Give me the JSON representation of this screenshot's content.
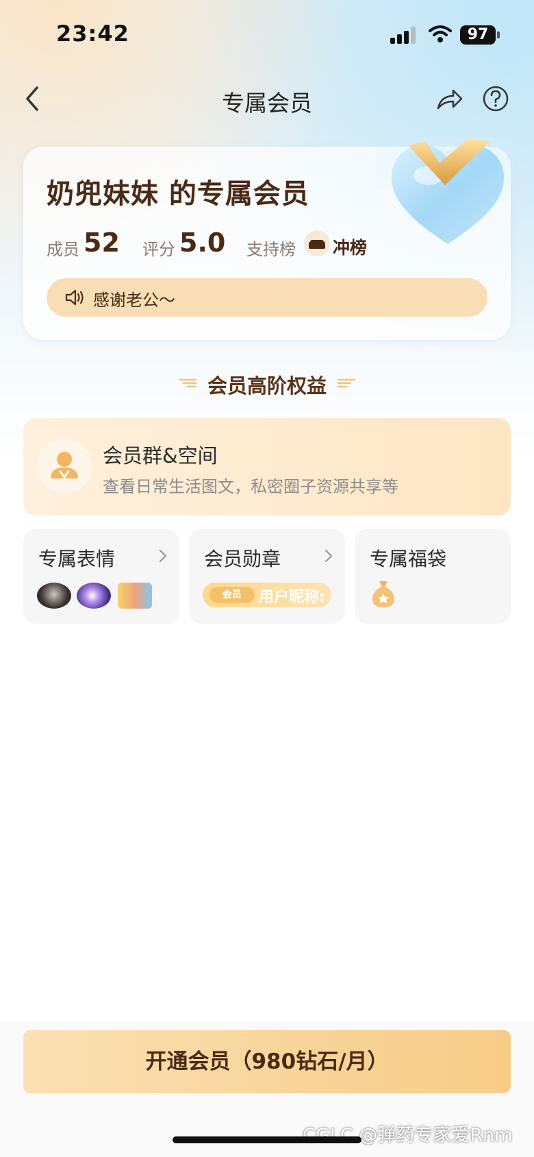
{
  "status_bar": {
    "time": "23:42",
    "battery": "97"
  },
  "nav": {
    "title": "专属会员",
    "back_icon": "chevron-left-icon",
    "share_icon": "share-arrow-icon",
    "help_icon": "question-circle-icon"
  },
  "member_card": {
    "title": "奶兜妹妹 的专属会员",
    "members_label": "成员",
    "members_value": "52",
    "rating_label": "评分",
    "rating_value": "5.0",
    "support_label": "支持榜",
    "rank_action": "冲榜",
    "notice_text": "感谢老公～"
  },
  "section": {
    "title": "会员高阶权益"
  },
  "benefits": {
    "group": {
      "title": "会员群&空间",
      "desc": "查看日常生活图文，私密圈子资源共享等"
    },
    "emoji": {
      "title": "专属表情"
    },
    "badge": {
      "title": "会员勋章",
      "pill_tag": "会员",
      "pill_nick": "用户昵称:"
    },
    "lucky_bag": {
      "title": "专属福袋"
    }
  },
  "bottom": {
    "open_button": "开通会员（980钻石/月）",
    "watermark": "CGLC @弹药专家爱Rnm"
  },
  "colors": {
    "accent": "#f7cc87",
    "text_brown": "#4a2a16"
  }
}
